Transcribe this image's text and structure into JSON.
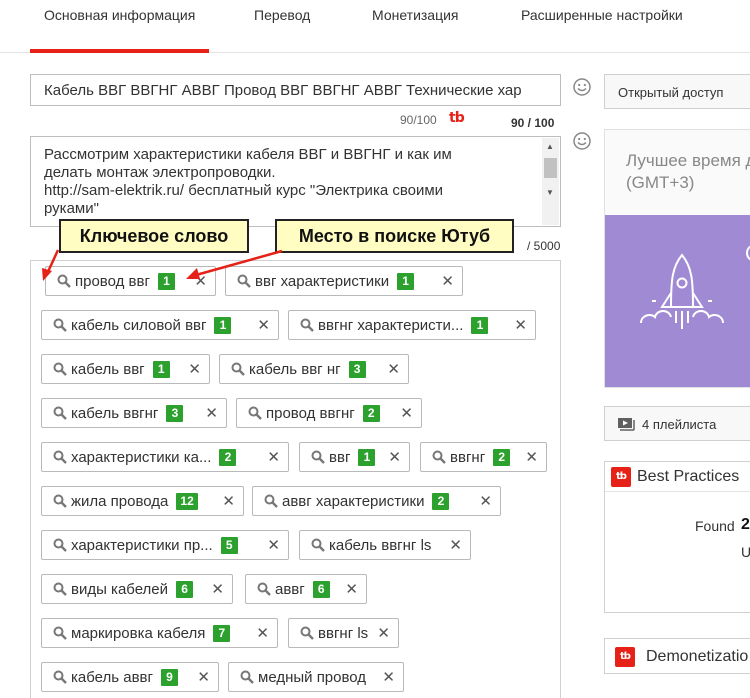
{
  "tabs": [
    {
      "label": "Основная информация"
    },
    {
      "label": "Перевод"
    },
    {
      "label": "Монетизация"
    },
    {
      "label": "Расширенные настройки"
    }
  ],
  "accent_color": "#e62117",
  "badge_color": "#2da12d",
  "title_field": {
    "value": "Кабель ВВГ ВВГНГ АВВГ Провод ВВГ ВВГНГ АВВГ Технические хар",
    "counter": "90/100",
    "tb_counter": "90 / 100"
  },
  "description_field": {
    "lines": [
      "Рассмотрим характеристики кабеля ВВГ и ВВГНГ и как им",
      "делать монтаж электропроводки.",
      "http://sam-elektrik.ru/ бесплатный курс \"Электрика своими",
      "руками\""
    ],
    "counter": "/ 5000"
  },
  "annotations": {
    "keyword": "Ключевое слово",
    "search_position": "Место в поиске Ютуб"
  },
  "tags": [
    {
      "label": "провод ввг",
      "rank": "1"
    },
    {
      "label": "ввг характеристики",
      "rank": "1"
    },
    {
      "label": "кабель силовой ввг",
      "rank": "1"
    },
    {
      "label": "ввгнг характеристи...",
      "rank": "1"
    },
    {
      "label": "кабель ввг",
      "rank": "1"
    },
    {
      "label": "кабель ввг нг",
      "rank": "3"
    },
    {
      "label": "кабель ввгнг",
      "rank": "3"
    },
    {
      "label": "провод ввгнг",
      "rank": "2"
    },
    {
      "label": "характеристики ка...",
      "rank": "2"
    },
    {
      "label": "ввг",
      "rank": "1"
    },
    {
      "label": "ввгнг",
      "rank": "2"
    },
    {
      "label": "жила провода",
      "rank": "12"
    },
    {
      "label": "аввг характеристики",
      "rank": "2"
    },
    {
      "label": "характеристики пр...",
      "rank": "5"
    },
    {
      "label": "кабель ввгнг ls",
      "rank": ""
    },
    {
      "label": "виды кабелей",
      "rank": "6"
    },
    {
      "label": "аввг",
      "rank": "6"
    },
    {
      "label": "маркировка кабеля",
      "rank": "7"
    },
    {
      "label": "ввгнг ls",
      "rank": ""
    },
    {
      "label": "кабель аввг",
      "rank": "9"
    },
    {
      "label": "медный провод",
      "rank": ""
    }
  ],
  "right_panel": {
    "access_button": "Открытый доступ",
    "best_time": {
      "line1": "Лучшее время д",
      "line2": "(GMT+3)"
    },
    "playlists_button": "4 плейлиста",
    "best_practices": {
      "title": "Best Practices",
      "found": "Found",
      "found_count": "2",
      "extra": "U"
    },
    "demonetization": {
      "title": "Demonetizatio"
    },
    "tb_logo_text": "tb",
    "purple_color": "#a08ad4"
  }
}
